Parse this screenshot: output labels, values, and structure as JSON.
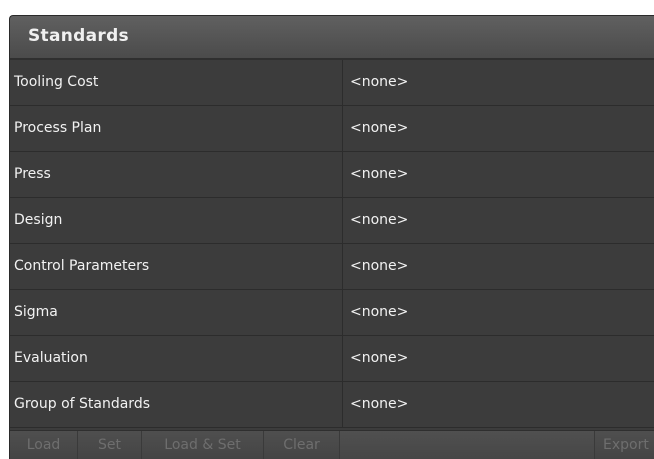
{
  "panel": {
    "title": "Standards"
  },
  "rows": [
    {
      "label": "Tooling Cost",
      "value": "<none>"
    },
    {
      "label": "Process Plan",
      "value": "<none>"
    },
    {
      "label": "Press",
      "value": "<none>"
    },
    {
      "label": "Design",
      "value": "<none>"
    },
    {
      "label": "Control Parameters",
      "value": "<none>"
    },
    {
      "label": "Sigma",
      "value": "<none>"
    },
    {
      "label": "Evaluation",
      "value": "<none>"
    },
    {
      "label": "Group of Standards",
      "value": "<none>"
    }
  ],
  "footer": {
    "load_label": "Load",
    "set_label": "Set",
    "load_set_label": "Load & Set",
    "clear_label": "Clear",
    "export_label": "Export"
  }
}
